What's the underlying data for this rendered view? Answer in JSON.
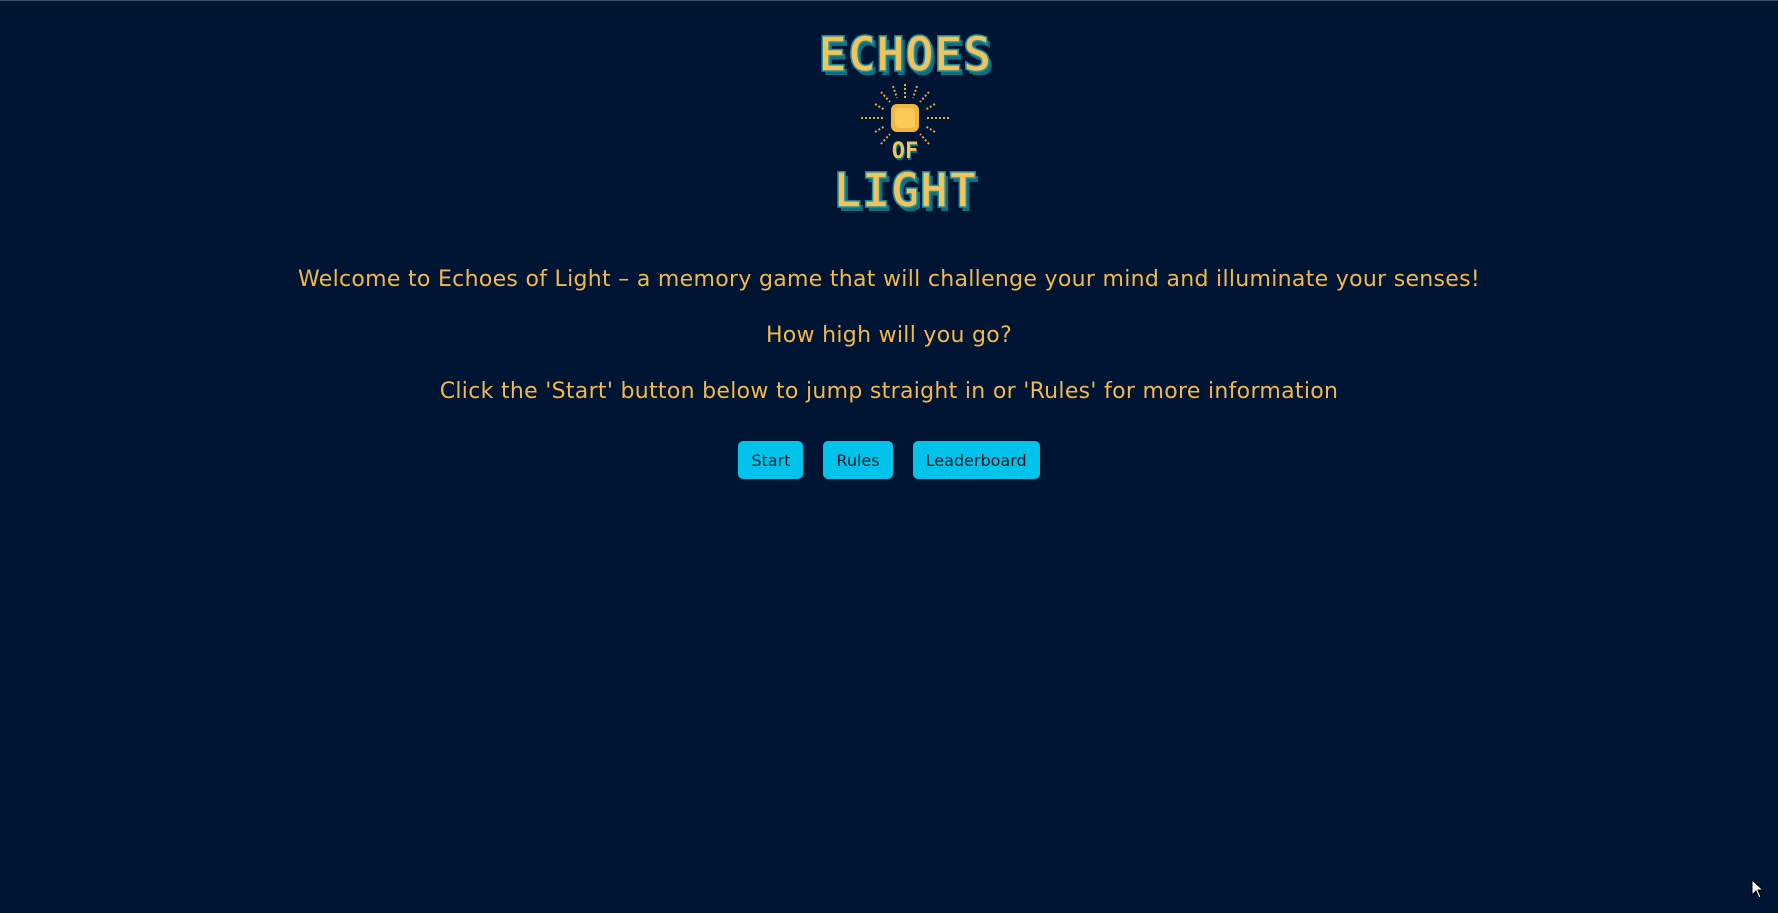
{
  "logo": {
    "line1": "ECHOES",
    "line2": "OF",
    "line3": "LIGHT",
    "icon": "sun-icon"
  },
  "intro": {
    "welcome": "Welcome to Echoes of Light – a memory game that will challenge your mind and illuminate your senses!",
    "question": "How high will you go?",
    "instruction": "Click the 'Start' button below to jump straight in or 'Rules' for more information"
  },
  "buttons": {
    "start": "Start",
    "rules": "Rules",
    "leaderboard": "Leaderboard"
  },
  "colors": {
    "background": "#001433",
    "text": "#f2b84b",
    "button": "#00c3ec",
    "logo_teal": "#0e7a8a"
  }
}
